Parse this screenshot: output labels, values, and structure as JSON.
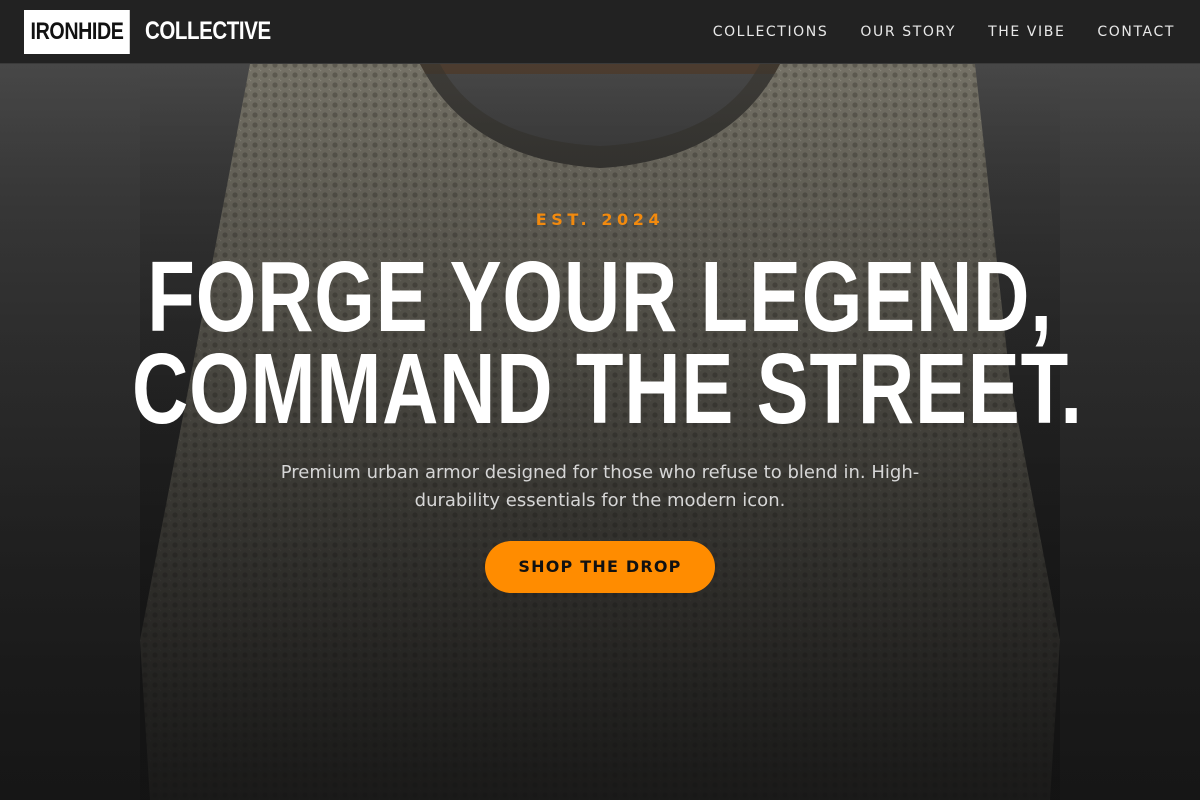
{
  "brand": {
    "logo_box_text": "IRONHIDE",
    "logo_word_text": "COLLECTIVE"
  },
  "nav": {
    "items": [
      {
        "label": "COLLECTIONS"
      },
      {
        "label": "OUR STORY"
      },
      {
        "label": "THE VIBE"
      },
      {
        "label": "CONTACT"
      }
    ]
  },
  "hero": {
    "eyebrow": "EST. 2024",
    "headline_line1": "FORGE YOUR LEGEND,",
    "headline_line2": "COMMAND THE STREET.",
    "subtext": "Premium urban armor designed for those who refuse to blend in. High-durability essentials for the modern icon.",
    "cta_label": "SHOP THE DROP",
    "background_image": "knit-sweater-on-hanger"
  },
  "colors": {
    "accent": "#ff8c00",
    "eyebrow": "#f28a0e",
    "navbar_bg": "#222222",
    "headline": "#ffffff"
  }
}
